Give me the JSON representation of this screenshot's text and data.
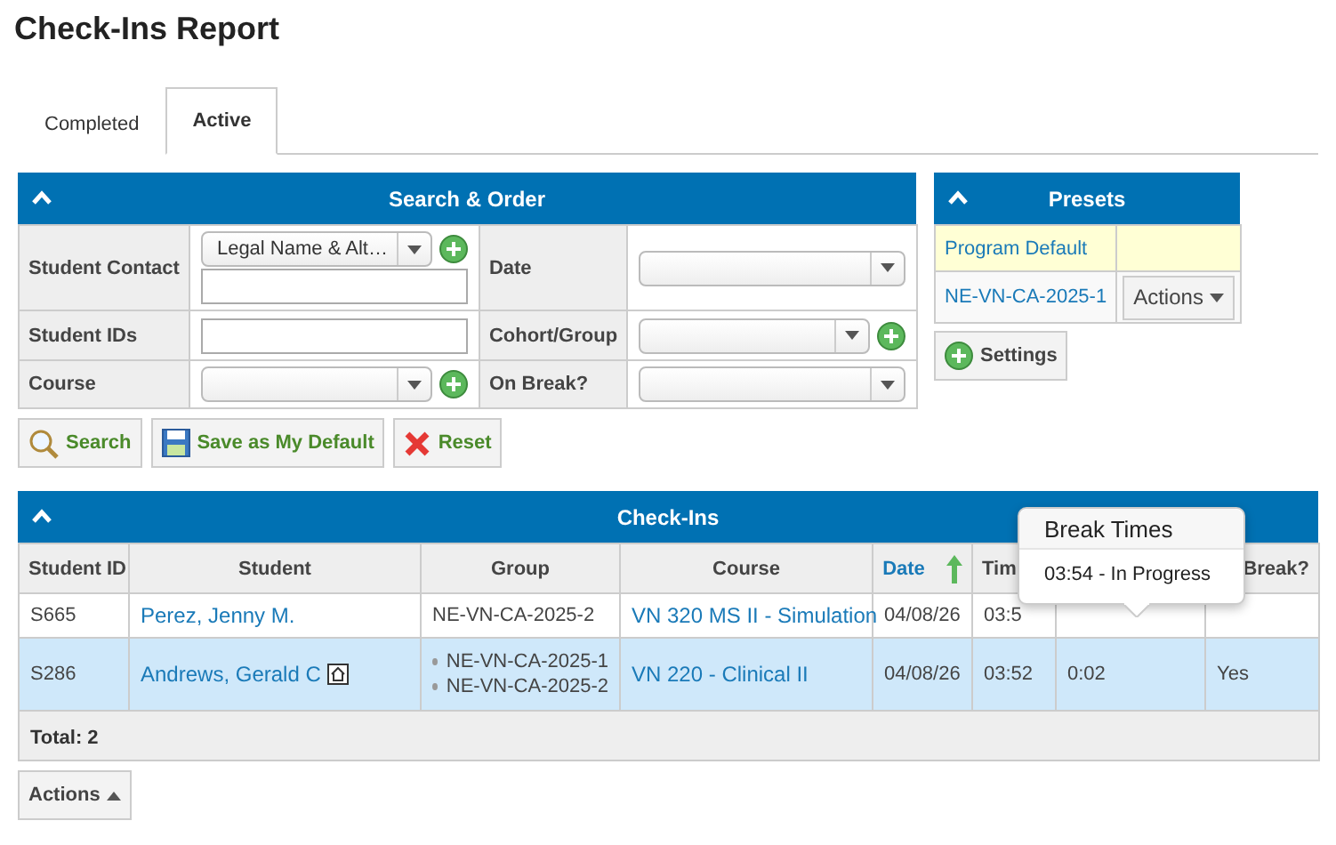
{
  "page_title": "Check-Ins Report",
  "tabs": [
    {
      "label": "Completed",
      "selected": false
    },
    {
      "label": "Active",
      "selected": true
    }
  ],
  "search_panel": {
    "title": "Search & Order",
    "rows": [
      {
        "left": {
          "label": "Student Contact",
          "kind": "select_with_input",
          "value": "Legal Name & Alt…",
          "add": true
        },
        "right": {
          "label": "Date",
          "kind": "select",
          "add": false
        }
      },
      {
        "left": {
          "label": "Student IDs",
          "kind": "text"
        },
        "right": {
          "label": "Cohort/Group",
          "kind": "select",
          "add": true
        }
      },
      {
        "left": {
          "label": "Course",
          "kind": "select",
          "add": true
        },
        "right": {
          "label": "On Break?",
          "kind": "select",
          "add": false
        }
      }
    ],
    "buttons": [
      {
        "label": "Search",
        "kind": "search"
      },
      {
        "label": "Save as My Default",
        "kind": "save"
      },
      {
        "label": "Reset",
        "kind": "reset"
      }
    ]
  },
  "presets_panel": {
    "title": "Presets",
    "items": [
      {
        "name": "Program Default",
        "selected": true
      },
      {
        "name": "NE-VN-CA-2025-1",
        "selected": false,
        "actions": "Actions"
      }
    ],
    "settings_button": "Settings"
  },
  "checkins_panel": {
    "title": "Check-Ins",
    "columns": [
      {
        "label": "Student ID",
        "sorted": false
      },
      {
        "label": "Student",
        "sorted": false
      },
      {
        "label": "Group",
        "sorted": false
      },
      {
        "label": "Course",
        "sorted": false
      },
      {
        "label": "Date",
        "sorted": true
      },
      {
        "label": "Tim",
        "sorted": false
      },
      {},
      {
        "label": "Break?",
        "sorted": false
      }
    ],
    "rows": [
      {
        "selected": false,
        "student_id": "S665",
        "student": "Perez, Jenny M.",
        "home_marker": false,
        "groups": [
          "NE-VN-CA-2025-2"
        ],
        "course": "VN 320 MS II - Simulation",
        "date": "04/08/26",
        "time": "03:5"
      },
      {
        "selected": true,
        "student_id": "S286",
        "student": "Andrews, Gerald C",
        "home_marker": true,
        "groups": [
          "NE-VN-CA-2025-1",
          "NE-VN-CA-2025-2"
        ],
        "course": "VN 220 - Clinical II",
        "date": "04/08/26",
        "time": "03:52",
        "duration": "0:02",
        "on_break": "Yes"
      }
    ],
    "total": "Total: 2",
    "popover": {
      "title": "Break Times",
      "items": [
        "03:54 - In Progress"
      ]
    }
  },
  "actions_button": "Actions"
}
